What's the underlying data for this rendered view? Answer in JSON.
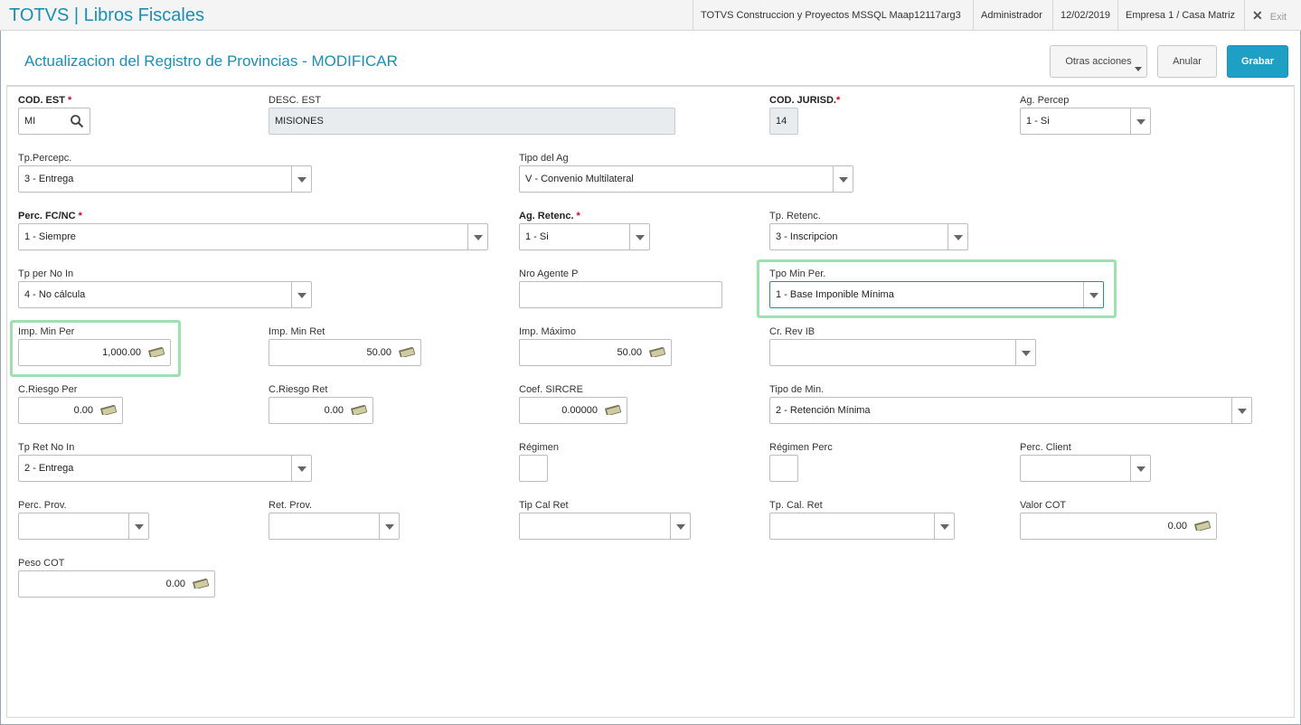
{
  "app": {
    "title": "TOTVS | Libros Fiscales",
    "environment": "TOTVS Construccion y Proyectos MSSQL Maap12117arg3",
    "user": "Administrador",
    "date": "12/02/2019",
    "company": "Empresa 1 / Casa Matriz",
    "exit_label": "Exit"
  },
  "page": {
    "title": "Actualizacion del Registro de Provincias - MODIFICAR",
    "actions": {
      "other_label": "Otras acciones",
      "cancel_label": "Anular",
      "save_label": "Grabar"
    }
  },
  "form": {
    "cod_est": {
      "label": "COD. EST",
      "value": "MI"
    },
    "desc_est": {
      "label": "DESC. EST",
      "value": "MISIONES"
    },
    "cod_jurisd": {
      "label": "COD. JURISD.",
      "value": "14"
    },
    "ag_percep": {
      "label": "Ag. Percep",
      "value": "1 - Si"
    },
    "tp_percepc": {
      "label": "Tp.Percepc.",
      "value": "3 - Entrega"
    },
    "tipo_del_ag": {
      "label": "Tipo del Ag",
      "value": "V - Convenio Multilateral"
    },
    "perc_fc_nc": {
      "label": "Perc. FC/NC",
      "value": "1 - Siempre"
    },
    "ag_retenc": {
      "label": "Ag. Retenc.",
      "value": "1 - Si"
    },
    "tp_retenc": {
      "label": "Tp. Retenc.",
      "value": "3 - Inscripcion"
    },
    "tp_per_no_in": {
      "label": "Tp per No In",
      "value": "4 - No cálcula"
    },
    "nro_agente_p": {
      "label": "Nro Agente P",
      "value": ""
    },
    "tpo_min_per": {
      "label": "Tpo Min Per.",
      "value": "1 - Base Imponible Mínima"
    },
    "imp_min_per": {
      "label": "Imp. Min Per",
      "value": "1,000.00"
    },
    "imp_min_ret": {
      "label": "Imp. Min Ret",
      "value": "50.00"
    },
    "imp_maximo": {
      "label": "Imp. Máximo",
      "value": "50.00"
    },
    "cr_rev_ib": {
      "label": "Cr. Rev IB",
      "value": ""
    },
    "c_riesgo_per": {
      "label": "C.Riesgo Per",
      "value": "0.00"
    },
    "c_riesgo_ret": {
      "label": "C.Riesgo Ret",
      "value": "0.00"
    },
    "coef_sircre": {
      "label": "Coef. SIRCRE",
      "value": "0.00000"
    },
    "tipo_de_min": {
      "label": "Tipo de Min.",
      "value": "2 - Retención Mínima"
    },
    "tp_ret_no_in": {
      "label": "Tp Ret No In",
      "value": "2 - Entrega"
    },
    "regimen": {
      "label": "Régimen",
      "value": ""
    },
    "regimen_perc": {
      "label": "Régimen Perc",
      "value": ""
    },
    "perc_client": {
      "label": "Perc. Client",
      "value": ""
    },
    "perc_prov": {
      "label": "Perc. Prov.",
      "value": ""
    },
    "ret_prov": {
      "label": "Ret. Prov.",
      "value": ""
    },
    "tip_cal_ret": {
      "label": "Tip Cal Ret",
      "value": ""
    },
    "tp_cal_ret": {
      "label": "Tp. Cal. Ret",
      "value": ""
    },
    "valor_cot": {
      "label": "Valor COT",
      "value": "0.00"
    },
    "peso_cot": {
      "label": "Peso COT",
      "value": "0.00"
    }
  },
  "required_marker": "*",
  "colors": {
    "brand": "#1a8fb3",
    "primary_button": "#1da0c3",
    "highlight": "#9fe0b0",
    "required": "#d0021b"
  }
}
